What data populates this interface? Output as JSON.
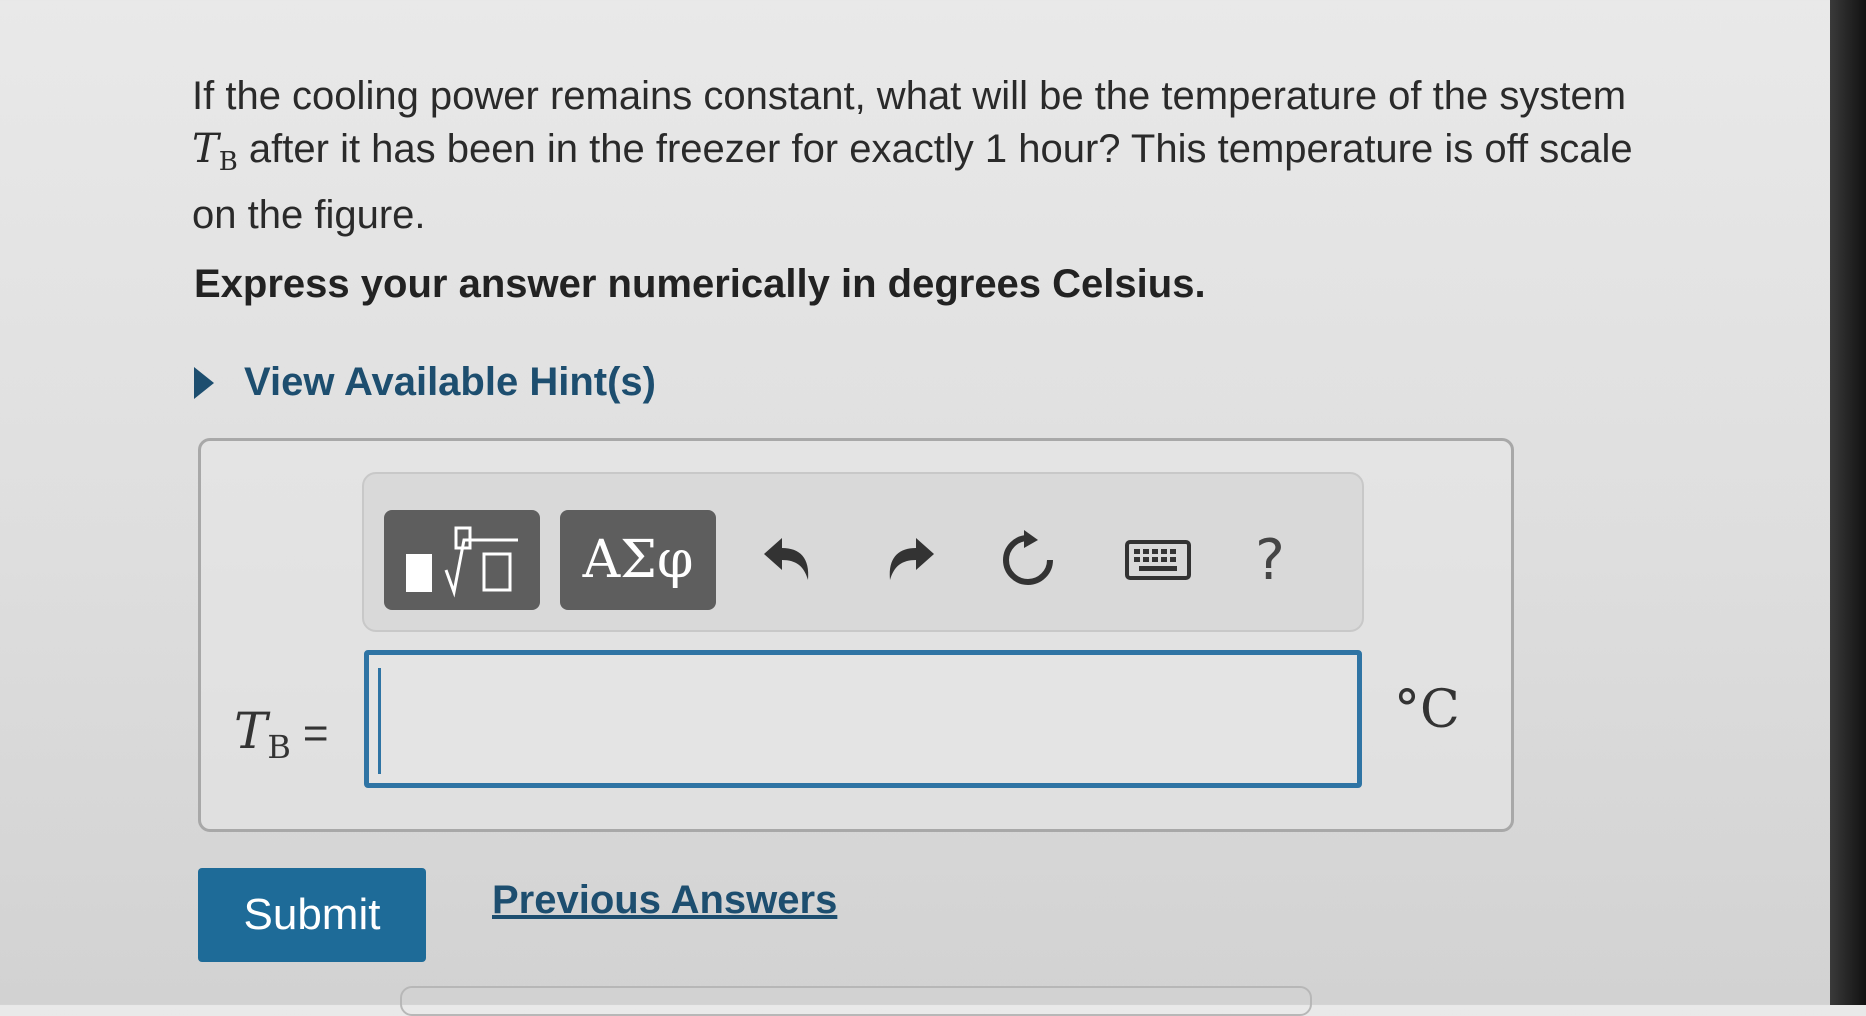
{
  "question": {
    "text_part1": "If the cooling power remains constant, what will be the temperature of the system ",
    "var_symbol": "T",
    "var_subscript": "B",
    "text_part2": " after it has been in the freezer for exactly 1 hour? This temperature is off scale on the figure."
  },
  "instruction": "Express your answer numerically in degrees Celsius.",
  "hints": {
    "label": "View Available Hint(s)"
  },
  "toolbar": {
    "greek_label": "ΑΣφ",
    "help_label": "?",
    "icons": [
      "templates-icon",
      "undo-icon",
      "redo-icon",
      "reset-icon",
      "keyboard-icon",
      "help-icon"
    ]
  },
  "answer": {
    "label_var": "T",
    "label_sub": "B",
    "equals": "=",
    "value": "",
    "unit": "°C"
  },
  "actions": {
    "submit_label": "Submit",
    "previous_label": "Previous Answers"
  },
  "colors": {
    "accent": "#1e6b98",
    "link": "#1d4e6f",
    "toolbar_button": "#5e5e5e"
  }
}
